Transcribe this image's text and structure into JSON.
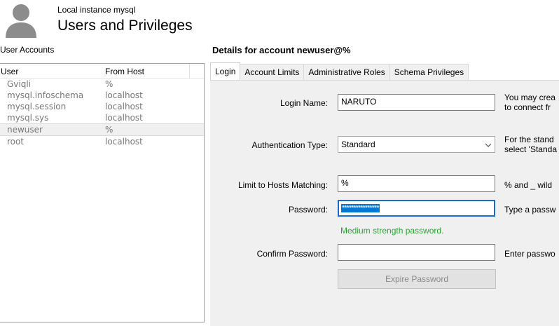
{
  "header": {
    "instance": "Local instance mysql",
    "title": "Users and Privileges"
  },
  "user_accounts": {
    "label": "User Accounts",
    "columns": [
      "User",
      "From Host"
    ],
    "rows": [
      {
        "user": "Gviqli",
        "host": "%"
      },
      {
        "user": "mysql.infoschema",
        "host": "localhost"
      },
      {
        "user": "mysql.session",
        "host": "localhost"
      },
      {
        "user": "mysql.sys",
        "host": "localhost"
      },
      {
        "user": "newuser",
        "host": "%"
      },
      {
        "user": "root",
        "host": "localhost"
      }
    ],
    "selected_index": 4
  },
  "details": {
    "title": "Details for account newuser@%",
    "tabs": [
      "Login",
      "Account Limits",
      "Administrative Roles",
      "Schema Privileges"
    ],
    "active_tab": 0
  },
  "form": {
    "login_name": {
      "label": "Login Name:",
      "value": "NARUTO",
      "help": [
        "You may crea",
        "to connect fr"
      ]
    },
    "auth_type": {
      "label": "Authentication Type:",
      "value": "Standard",
      "help": [
        "For the stand",
        "select 'Standa"
      ]
    },
    "hosts": {
      "label": "Limit to Hosts Matching:",
      "value": "%",
      "help": "% and _ wild"
    },
    "password": {
      "label": "Password:",
      "value": "****************",
      "help": "Type a passw"
    },
    "strength": "Medium strength password.",
    "confirm": {
      "label": "Confirm Password:",
      "value": "",
      "help": "Enter passwo"
    },
    "expire_button": "Expire Password"
  },
  "colors": {
    "accent": "#0078d7",
    "strength": "#2aa532",
    "panel_bg": "#f0f0f0"
  },
  "icons": {
    "avatar": "user-avatar-icon",
    "dropdown": "chevron-down-icon"
  }
}
